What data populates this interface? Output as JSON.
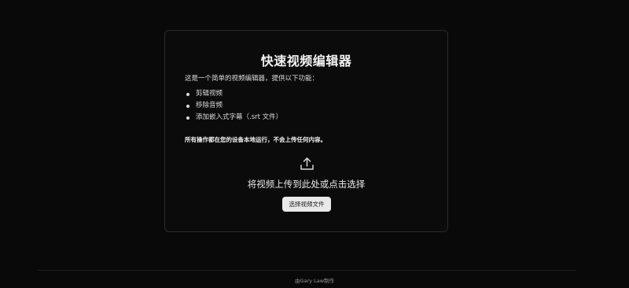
{
  "app": {
    "title": "快速视频编辑器",
    "intro": "这是一个简单的视频编辑器，提供以下功能：",
    "features": [
      "剪辑视频",
      "移除音频",
      "添加嵌入式字幕（.srt 文件）"
    ],
    "notice": "所有操作都在您的设备本地运行，不会上传任何内容。"
  },
  "upload": {
    "icon": "upload-icon",
    "prompt": "将视频上传到此处或点击选择",
    "button_label": "选择视频文件"
  },
  "footer": {
    "credit": "由Gary Law制作"
  },
  "colors": {
    "background": "#090909",
    "card_border": "#2a2a2a",
    "button_bg": "#e9e9e9",
    "text": "#e8e8e8"
  }
}
